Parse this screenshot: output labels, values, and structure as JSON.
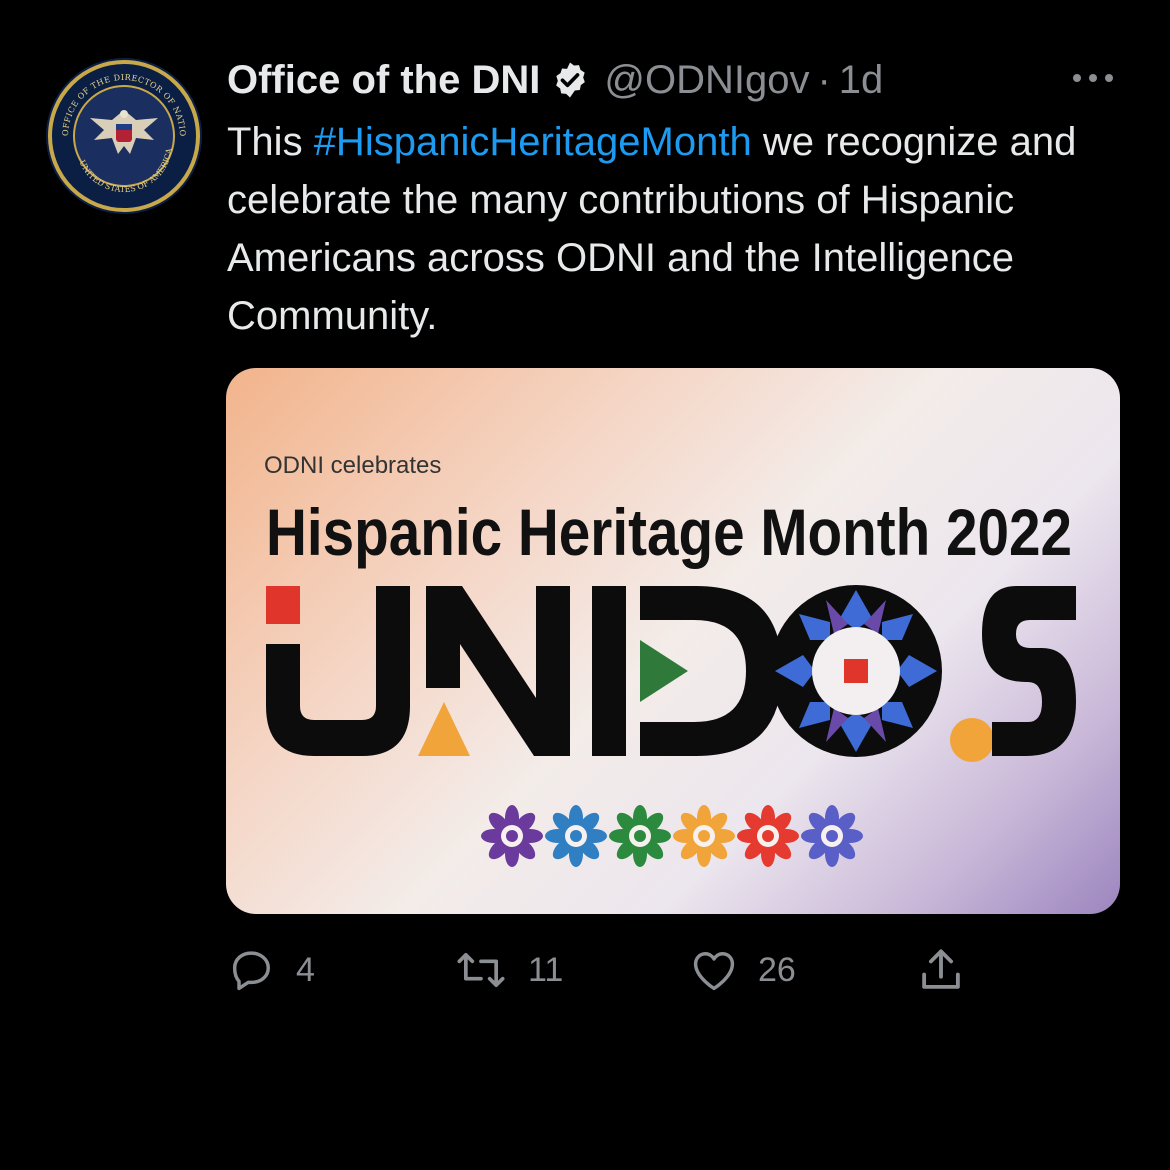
{
  "tweet": {
    "author_name": "Office of the DNI",
    "handle": "@ODNIgov",
    "separator": "·",
    "timestamp": "1d",
    "text_prefix": "This ",
    "hashtag": "#HispanicHeritageMonth",
    "text_suffix": " we recognize and celebrate the many contributions of Hispanic Americans across ODNI and the Intelligence Community."
  },
  "seal": {
    "outer_text": "OFFICE OF THE DIRECTOR OF NATIONAL INTELLIGENCE",
    "bottom_text": "UNITED STATES OF AMERICA"
  },
  "media": {
    "kicker": "ODNI celebrates",
    "headline": "Hispanic Heritage Month 2022",
    "logo_word": "UNIDOS",
    "flower_colors": [
      "#6a3a9c",
      "#2f7fc2",
      "#2c8a3e",
      "#f0a43a",
      "#e53a2f",
      "#5a5fc8"
    ]
  },
  "actions": {
    "replies": "4",
    "retweets": "11",
    "likes": "26"
  },
  "colors": {
    "background": "#000000",
    "text": "#e7e9ea",
    "secondary": "#8b8f94",
    "link": "#1d9bf0"
  }
}
